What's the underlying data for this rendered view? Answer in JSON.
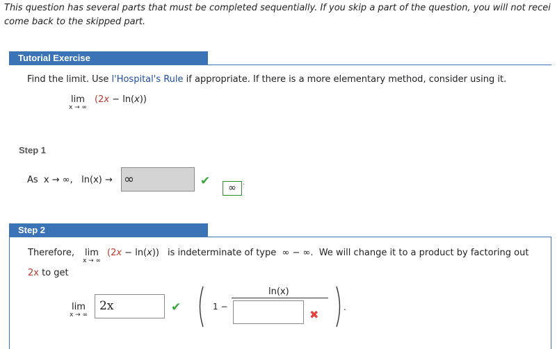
{
  "intro": {
    "line1": "This question has several parts that must be completed sequentially. If you skip a part of the question, you will not recei",
    "line2": "come back to the skipped part."
  },
  "tutorial": {
    "tab_label": "Tutorial Exercise",
    "prompt_before": "Find the limit. Use ",
    "prompt_link": "l'Hospital's Rule",
    "prompt_after": " if appropriate. If there is a more elementary method, consider using it.",
    "lim": "lim",
    "lim_sub": "x → ∞",
    "expression": "(2x − ln(x))"
  },
  "step1": {
    "label": "Step 1",
    "text": "As  x → ∞,   ln(x) →",
    "answer_value": "∞",
    "check_icon": "✔",
    "key_value": "∞"
  },
  "step2": {
    "tab_label": "Step 2",
    "therefore": "Therefore,",
    "lim": "lim",
    "lim_sub": "x → ∞",
    "expression": "(2x − ln(x))",
    "middle_text": "is indeterminate of type  ∞ − ∞.  We will change it to a product by factoring out",
    "factor": "2x",
    "to_get": " to get",
    "answer_lim": "lim",
    "answer_lim_sub": "x → ∞",
    "answer_value": "2x",
    "check_icon": "✔",
    "one_minus": "1 −",
    "numerator": "ln(x)",
    "denominator_value": "",
    "cross_icon": "✖",
    "period": "."
  },
  "colors": {
    "tab_blue": "#3a74b6",
    "link_blue": "#1f4da1",
    "red": "#c0392b",
    "check_green": "#3aa53a"
  }
}
